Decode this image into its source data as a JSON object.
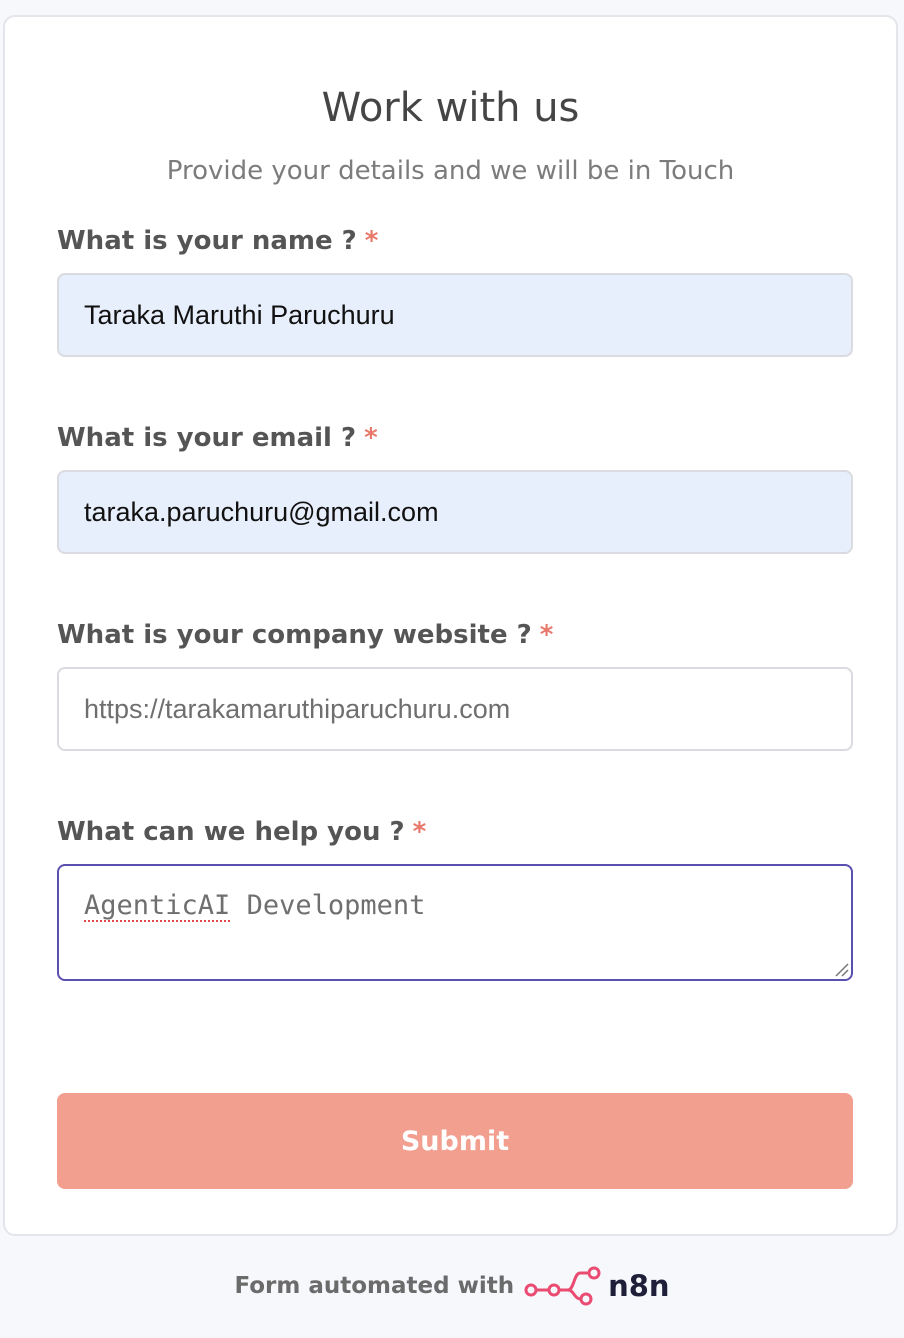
{
  "form": {
    "title": "Work with us",
    "subtitle": "Provide your details and we will be in Touch",
    "fields": [
      {
        "label": "What is your name ?",
        "required_mark": "*",
        "value": "Taraka Maruthi Paruchuru"
      },
      {
        "label": "What is your email ?",
        "required_mark": "*",
        "value": "taraka.paruchuru@gmail.com"
      },
      {
        "label": "What is your company website ?",
        "required_mark": "*",
        "placeholder": "https://tarakamaruthiparuchuru.com"
      },
      {
        "label": "What can we help you ?",
        "required_mark": "*",
        "placeholder_word1": "AgenticAI",
        "placeholder_word2": " Development"
      }
    ],
    "submit_label": "Submit"
  },
  "footer": {
    "text": "Form automated with",
    "logo_text": "n8n"
  },
  "colors": {
    "accent": "#e8786a",
    "submit_bg": "#f29f8f",
    "focus_border": "#5b4fb0",
    "autofill_bg": "#e8effc"
  },
  "icons": [
    "n8n-logo-icon",
    "resize-handle-icon"
  ]
}
